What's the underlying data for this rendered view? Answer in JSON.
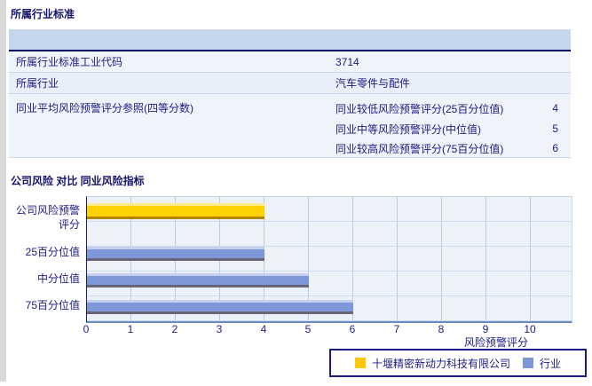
{
  "colors": {
    "text_navy": "#1b1b85",
    "table_header_bg": "#c7d6ef",
    "row_bg": "#eff3fa",
    "row_alt_bg": "#e9eff8",
    "company_series": "#FFD303",
    "industry_series": "#7E97D8",
    "legend_company_swatch": "#FFC800",
    "legend_industry_swatch": "#7E97D8"
  },
  "industry_section": {
    "title": "所属行业标准",
    "rows": [
      {
        "label": "所属行业标准工业代码",
        "value": "3714"
      },
      {
        "label": "所属行业",
        "value": "汽车零件与配件"
      },
      {
        "label": "同业平均风险预警评分参照(四等分数)"
      }
    ],
    "peer_scores": [
      {
        "label": "同业较低风险预警评分(25百分位值)",
        "value": "4"
      },
      {
        "label": "同业中等风险预警评分(中位值)",
        "value": "5"
      },
      {
        "label": "同业较高风险预警评分(75百分位值)",
        "value": "6"
      }
    ]
  },
  "chart_section": {
    "title": "公司风险 对比 同业风险指标"
  },
  "chart_data": {
    "type": "bar",
    "orientation": "horizontal",
    "title": "公司风险 对比 同业风险指标",
    "categories": [
      "公司风险预警评分",
      "25百分位值",
      "中分位值",
      "75百分位值"
    ],
    "ylabel_lines": [
      "公司风险预警",
      "评分",
      "25百分位值",
      "中分位值",
      "75百分位值"
    ],
    "series": [
      {
        "name": "十堰精密新动力科技有限公司",
        "color": "#FFD303",
        "values": [
          4,
          null,
          null,
          null
        ]
      },
      {
        "name": "行业",
        "color": "#7E97D8",
        "values": [
          null,
          4,
          5,
          6
        ]
      }
    ],
    "xlabel": "风险预警评分",
    "xlim": [
      0,
      10
    ],
    "xticks": [
      "0",
      "1",
      "2",
      "3",
      "4",
      "5",
      "6",
      "7",
      "8",
      "9",
      "10"
    ],
    "grid": true,
    "legend_position": "bottom"
  }
}
